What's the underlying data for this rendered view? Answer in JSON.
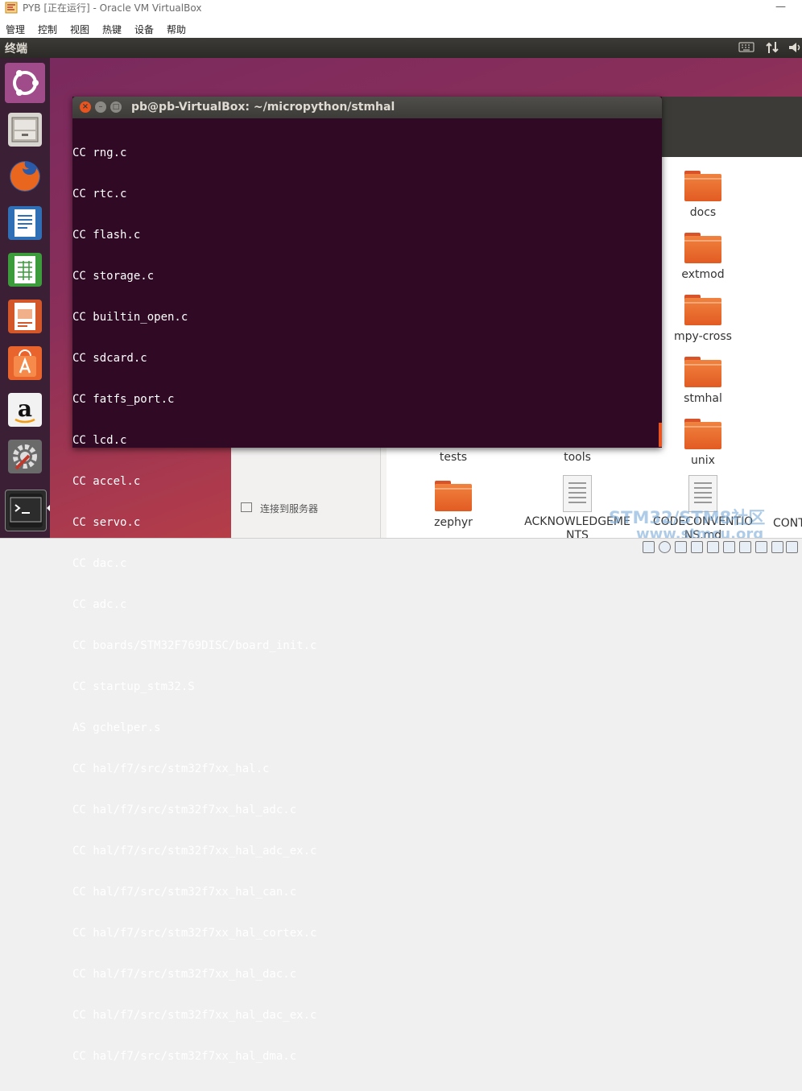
{
  "host_window": {
    "title": "PYB [正在运行] - Oracle VM VirtualBox",
    "minimize_glyph": "—",
    "menu": [
      "管理",
      "控制",
      "视图",
      "热键",
      "设备",
      "帮助"
    ]
  },
  "guest_top_panel": {
    "app_name": "终端",
    "indicators": [
      "keyboard-icon",
      "network-updown-icon",
      "volume-icon"
    ]
  },
  "launcher": {
    "items": [
      "ubuntu-dash-icon",
      "files-icon",
      "firefox-icon",
      "libreoffice-writer-icon",
      "libreoffice-calc-icon",
      "libreoffice-impress-icon",
      "software-center-icon",
      "amazon-icon",
      "system-settings-icon",
      "terminal-icon"
    ]
  },
  "file_manager": {
    "sidebar_item": "连接到服务器",
    "files": [
      {
        "name": "docs",
        "type": "folder"
      },
      {
        "name": "extmod",
        "type": "folder"
      },
      {
        "name": "mpy-cross",
        "type": "folder"
      },
      {
        "name": "stmhal",
        "type": "folder"
      },
      {
        "name": "tests",
        "type": "folder"
      },
      {
        "name": "tools",
        "type": "folder"
      },
      {
        "name": "unix",
        "type": "folder"
      },
      {
        "name": "zephyr",
        "type": "folder"
      },
      {
        "name": "ACKNOWLEDGEMENTS",
        "type": "document",
        "line1": "ACKNOWLEDGEME",
        "line2": "NTS"
      },
      {
        "name": "CODECONVENTIONS.md",
        "type": "document",
        "line1": "CODECONVENTIO",
        "line2": "NS.md"
      },
      {
        "name": "CONT",
        "type": "document",
        "line1": "CONT",
        "line2": ""
      }
    ]
  },
  "terminal": {
    "title": "pb@pb-VirtualBox: ~/micropython/stmhal",
    "close_glyph": "×",
    "min_glyph": "–",
    "max_glyph": "□",
    "lines": [
      "CC rng.c",
      "CC rtc.c",
      "CC flash.c",
      "CC storage.c",
      "CC builtin_open.c",
      "CC sdcard.c",
      "CC fatfs_port.c",
      "CC lcd.c",
      "CC accel.c",
      "CC servo.c",
      "CC dac.c",
      "CC adc.c",
      "CC boards/STM32F769DISC/board_init.c",
      "CC startup_stm32.S",
      "AS gchelper.s",
      "CC hal/f7/src/stm32f7xx_hal.c",
      "CC hal/f7/src/stm32f7xx_hal_adc.c",
      "CC hal/f7/src/stm32f7xx_hal_adc_ex.c",
      "CC hal/f7/src/stm32f7xx_hal_can.c",
      "CC hal/f7/src/stm32f7xx_hal_cortex.c",
      "CC hal/f7/src/stm32f7xx_hal_dac.c",
      "CC hal/f7/src/stm32f7xx_hal_dac_ex.c",
      "CC hal/f7/src/stm32f7xx_hal_dma.c"
    ]
  },
  "watermark": {
    "line1": "STM32/STM8社区",
    "line2": "www.stmcu.org"
  },
  "colors": {
    "terminal_bg": "#300a24",
    "ubuntu_orange": "#e95420",
    "launcher_bg": "#3b2035"
  }
}
